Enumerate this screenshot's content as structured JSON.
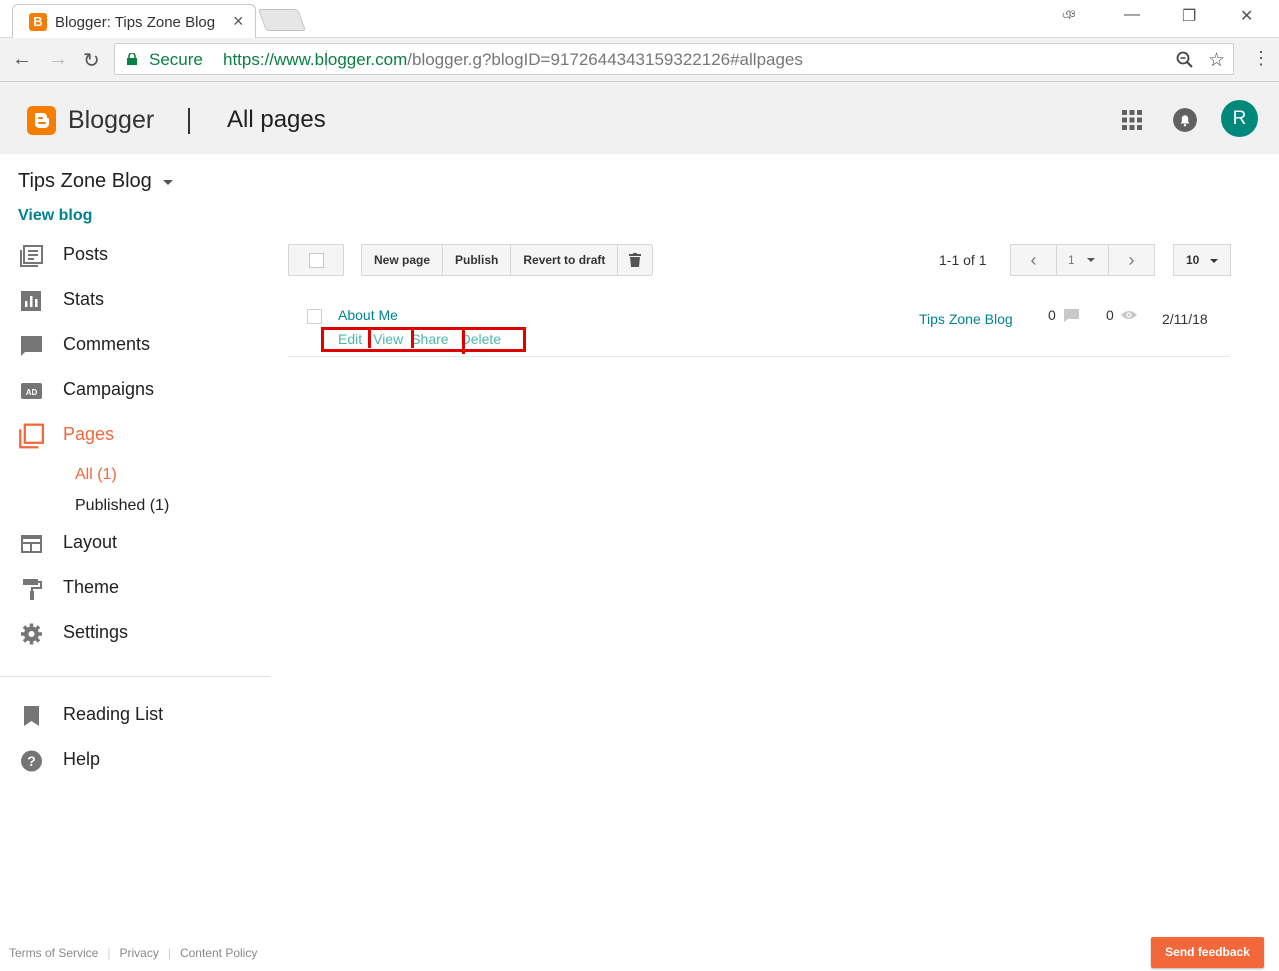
{
  "browser": {
    "tab_title": "Blogger: Tips Zone Blog",
    "tab_close": "×",
    "url_host": "https://www.blogger.com",
    "url_path": "/blogger.g?blogID=9172644343159322126#allpages",
    "secure_label": "Secure",
    "profile_label": "ঞ"
  },
  "header": {
    "app_name": "Blogger",
    "page_title": "All pages",
    "avatar_initial": "R"
  },
  "sidebar": {
    "blog_name": "Tips Zone Blog",
    "view_blog": "View blog",
    "items": [
      {
        "label": "Posts"
      },
      {
        "label": "Stats"
      },
      {
        "label": "Comments"
      },
      {
        "label": "Campaigns"
      },
      {
        "label": "Pages"
      },
      {
        "label": "Layout"
      },
      {
        "label": "Theme"
      },
      {
        "label": "Settings"
      }
    ],
    "pages_sub": [
      {
        "label": "All (1)"
      },
      {
        "label": "Published (1)"
      }
    ],
    "secondary": [
      {
        "label": "Reading List"
      },
      {
        "label": "Help"
      }
    ]
  },
  "toolbar": {
    "new_page": "New page",
    "publish": "Publish",
    "revert": "Revert to draft",
    "pager_text": "1-1 of 1",
    "page_number": "1",
    "per_page": "10"
  },
  "rows": [
    {
      "title": "About Me",
      "actions": [
        "Edit",
        "View",
        "Share",
        "Delete"
      ],
      "blog": "Tips Zone Blog",
      "comments": "0",
      "views": "0",
      "date": "2/11/18"
    }
  ],
  "footer": {
    "terms": "Terms of Service",
    "privacy": "Privacy",
    "content_policy": "Content Policy",
    "feedback": "Send feedback"
  },
  "colors": {
    "accent": "#f57d00",
    "active_nav": "#f2683a",
    "link": "#00838f",
    "highlight": "#e00000"
  }
}
